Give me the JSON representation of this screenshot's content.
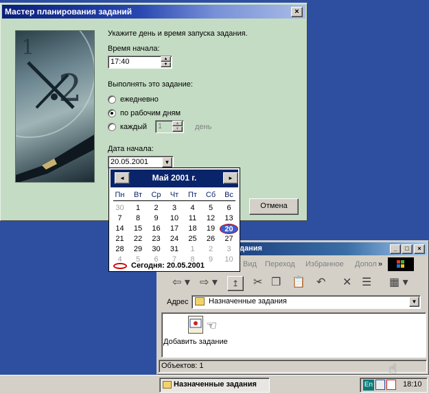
{
  "wizard": {
    "title": "Мастер планирования заданий",
    "close_glyph": "×",
    "instruction": "Укажите день и время запуска задания.",
    "start_time_label": "Время начала:",
    "start_time_value": "17:40",
    "perform_label": "Выполнять это задание:",
    "options": [
      {
        "label": "ежедневно",
        "checked": false
      },
      {
        "label": "по рабочим дням",
        "checked": true
      },
      {
        "label": "каждый",
        "checked": false
      }
    ],
    "every_value": "1",
    "every_unit": "день",
    "start_date_label": "Дата начала:",
    "start_date_value": "20.05.2001",
    "cancel_button": "Отмена"
  },
  "calendar": {
    "title": "Май 2001 г.",
    "prev_glyph": "◄",
    "next_glyph": "►",
    "weekdays": [
      "Пн",
      "Вт",
      "Ср",
      "Чт",
      "Пт",
      "Сб",
      "Вс"
    ],
    "weeks": [
      [
        "30",
        "1",
        "2",
        "3",
        "4",
        "5",
        "6"
      ],
      [
        "7",
        "8",
        "9",
        "10",
        "11",
        "12",
        "13"
      ],
      [
        "14",
        "15",
        "16",
        "17",
        "18",
        "19",
        "20"
      ],
      [
        "21",
        "22",
        "23",
        "24",
        "25",
        "26",
        "27"
      ],
      [
        "28",
        "29",
        "30",
        "31",
        "1",
        "2",
        "3"
      ],
      [
        "4",
        "5",
        "6",
        "7",
        "8",
        "9",
        "10"
      ]
    ],
    "selected_day": "20",
    "today_text": "Сегодня: 20.05.2001"
  },
  "explorer": {
    "title": "дания",
    "minimize_glyph": "_",
    "maximize_glyph": "□",
    "close_glyph": "×",
    "menu": [
      "Вид",
      "Переход",
      "Избранное",
      "Допол"
    ],
    "menu_more": "»",
    "address_label": "Адрес",
    "address_value": "Назначенные задания",
    "add_task_label": "Добавить задание",
    "status_text": "Объектов: 1"
  },
  "taskbar": {
    "task_button": "Назначенные задания",
    "lang_indicator": "En",
    "clock": "18:10"
  },
  "colors": {
    "wizard_bg": "#c4dcc4",
    "desktop": "#2e4fa0",
    "title_active": "#0a246a",
    "selected_day": "#3a5fcd",
    "today_ring": "#cc0000"
  }
}
